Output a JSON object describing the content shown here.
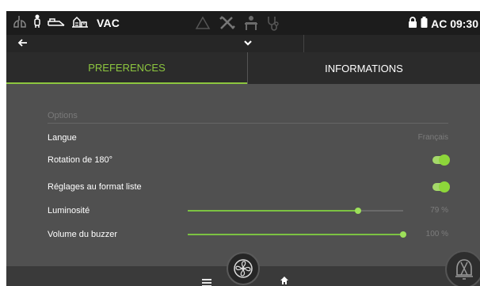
{
  "status": {
    "vac_label": "VAC",
    "time_label": "AC 09:30"
  },
  "tabs": [
    {
      "label": "PREFERENCES",
      "active": true
    },
    {
      "label": "INFORMATIONS",
      "active": false
    }
  ],
  "options": {
    "section_title": "Options",
    "langue": {
      "label": "Langue",
      "value": "Français"
    },
    "rotation": {
      "label": "Rotation de 180°",
      "on": true
    },
    "liste": {
      "label": "Réglages au format liste",
      "on": true
    },
    "luminosite": {
      "label": "Luminosité",
      "level": 0.79,
      "value_text": "79 %"
    },
    "buzzer": {
      "label": "Volume du buzzer",
      "level": 1.0,
      "value_text": "100 %"
    }
  },
  "colors": {
    "accent": "#8dc63f",
    "statusbar": "#1c1c1c",
    "panel": "#505050"
  },
  "icons": [
    "lungs-icon",
    "patient-icon",
    "bed-icon",
    "building-icon",
    "warning-icon",
    "tools-icon",
    "person-icon",
    "stethoscope-icon",
    "lock-icon",
    "battery-icon",
    "back-arrow-icon",
    "chevron-down-icon",
    "menu-icon",
    "fan-icon",
    "home-icon",
    "alarm-icon"
  ]
}
